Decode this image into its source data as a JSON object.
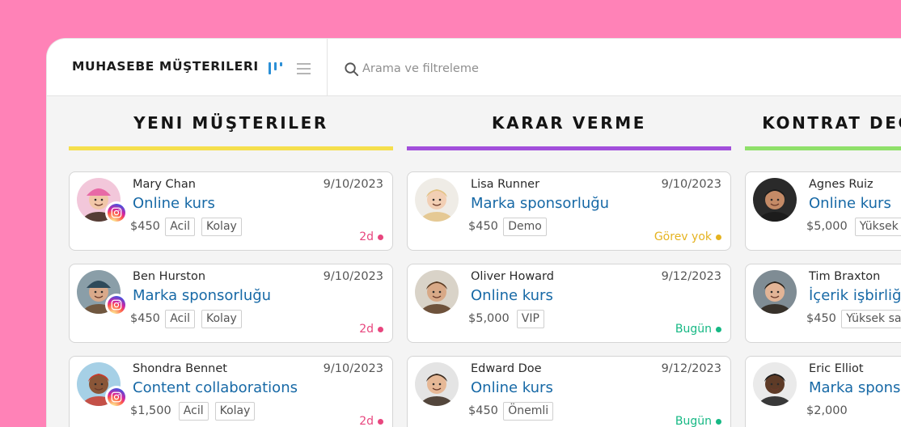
{
  "app": {
    "title": "MUHASEBE MÜŞTERILERI",
    "search_placeholder": "Arama ve filtreleme"
  },
  "colors": {
    "background_pink": "#ff82b7",
    "link_blue": "#1769a6",
    "kanban_icon": "#2b8fd6",
    "status_pink": "#e8467e",
    "status_yellow": "#e5b320",
    "status_green": "#16b884"
  },
  "columns": [
    {
      "title": "YENI MÜŞTERILER",
      "bar_color": "#f5df4d",
      "cards": [
        {
          "name": "Mary Chan",
          "date": "9/10/2023",
          "title": "Online kurs",
          "price": "$450",
          "tags": [
            "Acil",
            "Kolay"
          ],
          "status": "2d",
          "status_color": "#e8467e",
          "instagram": true,
          "avatar": "woman-pink-hat"
        },
        {
          "name": "Ben Hurston",
          "date": "9/10/2023",
          "title": "Marka sponsorluğu",
          "price": "$450",
          "tags": [
            "Acil",
            "Kolay"
          ],
          "status": "2d",
          "status_color": "#e8467e",
          "instagram": true,
          "avatar": "man-beanie"
        },
        {
          "name": "Shondra Bennet",
          "date": "9/10/2023",
          "title": "Content collaborations",
          "price": "$1,500",
          "tags": [
            "Acil",
            "Kolay"
          ],
          "status": "2d",
          "status_color": "#e8467e",
          "instagram": true,
          "avatar": "woman-red-hair"
        }
      ]
    },
    {
      "title": "KARAR VERME",
      "bar_color": "#a24fdb",
      "cards": [
        {
          "name": "Lisa Runner",
          "date": "9/10/2023",
          "title": "Marka sponsorluğu",
          "price": "$450",
          "tags": [
            "Demo"
          ],
          "status": "Görev yok",
          "status_color": "#e5b320",
          "instagram": false,
          "avatar": "woman-blonde"
        },
        {
          "name": "Oliver Howard",
          "date": "9/12/2023",
          "title": "Online kurs",
          "price": "$5,000",
          "tags": [
            "VIP"
          ],
          "status": "Bugün",
          "status_color": "#16b884",
          "instagram": false,
          "avatar": "man-beard"
        },
        {
          "name": "Edward Doe",
          "date": "9/12/2023",
          "title": "Online kurs",
          "price": "$450",
          "tags": [
            "Önemli"
          ],
          "status": "Bugün",
          "status_color": "#16b884",
          "instagram": false,
          "avatar": "man-smiling"
        }
      ]
    },
    {
      "title": "KONTRAT DEĞERLENDİRME",
      "bar_color": "#8fe06a",
      "cards": [
        {
          "name": "Agnes Ruiz",
          "date": "",
          "title": "Online kurs",
          "price": "$5,000",
          "tags": [
            "Yüksek satış"
          ],
          "status": "",
          "status_color": "",
          "instagram": false,
          "avatar": "woman-curly"
        },
        {
          "name": "Tim Braxton",
          "date": "",
          "title": "İçerik işbirliği",
          "price": "$450",
          "tags": [
            "Yüksek satış"
          ],
          "status": "",
          "status_color": "",
          "instagram": false,
          "avatar": "man-short-hair"
        },
        {
          "name": "Eric Elliot",
          "date": "",
          "title": "Marka sponsorluğu",
          "price": "$2,000",
          "tags": [],
          "status": "",
          "status_color": "",
          "instagram": false,
          "avatar": "man-dark-skin"
        }
      ]
    }
  ]
}
